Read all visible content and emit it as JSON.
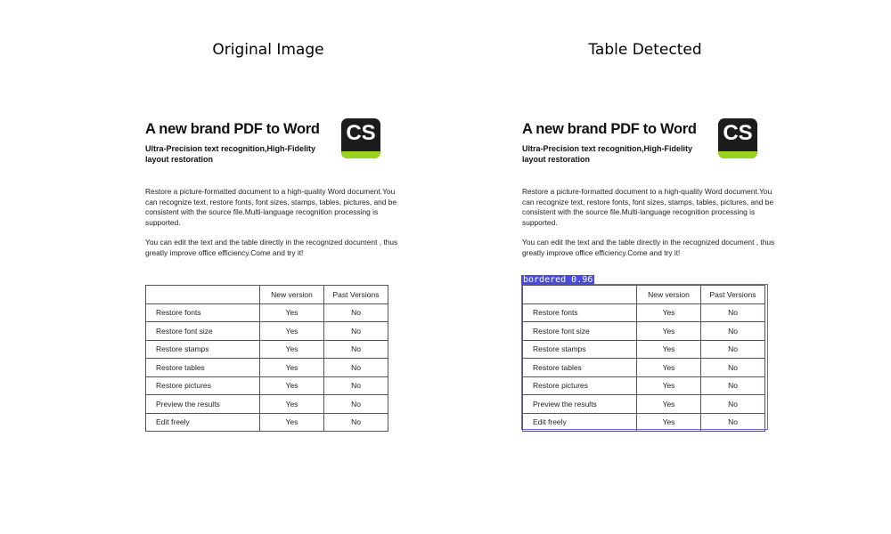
{
  "panels": {
    "left_title": "Original Image",
    "right_title": "Table Detected"
  },
  "document": {
    "title": "A new brand PDF to Word",
    "subtitle": "Ultra-Precision text recognition,High-Fidelity layout restoration",
    "logo_text": "CS",
    "logo_colors": {
      "background": "#1c1c1c",
      "accent": "#9ad31c"
    },
    "paragraph1": "Restore a picture-formatted document to a high-quality Word document.You can recognize text, restore fonts, font sizes, stamps, tables, pictures, and be consistent with the source file.Multi-language recognition processing is supported.",
    "paragraph2": "You can edit the text and  the table directly in the recognized document , thus greatly improve office efficiency.Come and try it!",
    "table": {
      "headers": [
        "",
        "New version",
        "Past Versions"
      ],
      "rows": [
        [
          "Restore fonts",
          "Yes",
          "No"
        ],
        [
          "Restore font size",
          "Yes",
          "No"
        ],
        [
          "Restore stamps",
          "Yes",
          "No"
        ],
        [
          "Restore tables",
          "Yes",
          "No"
        ],
        [
          "Restore pictures",
          "Yes",
          "No"
        ],
        [
          "Preview the results",
          "Yes",
          "No"
        ],
        [
          "Edit freely",
          "Yes",
          "No"
        ]
      ]
    }
  },
  "detection": {
    "label": "bordered 0.96",
    "color": "#4b4bdc"
  }
}
